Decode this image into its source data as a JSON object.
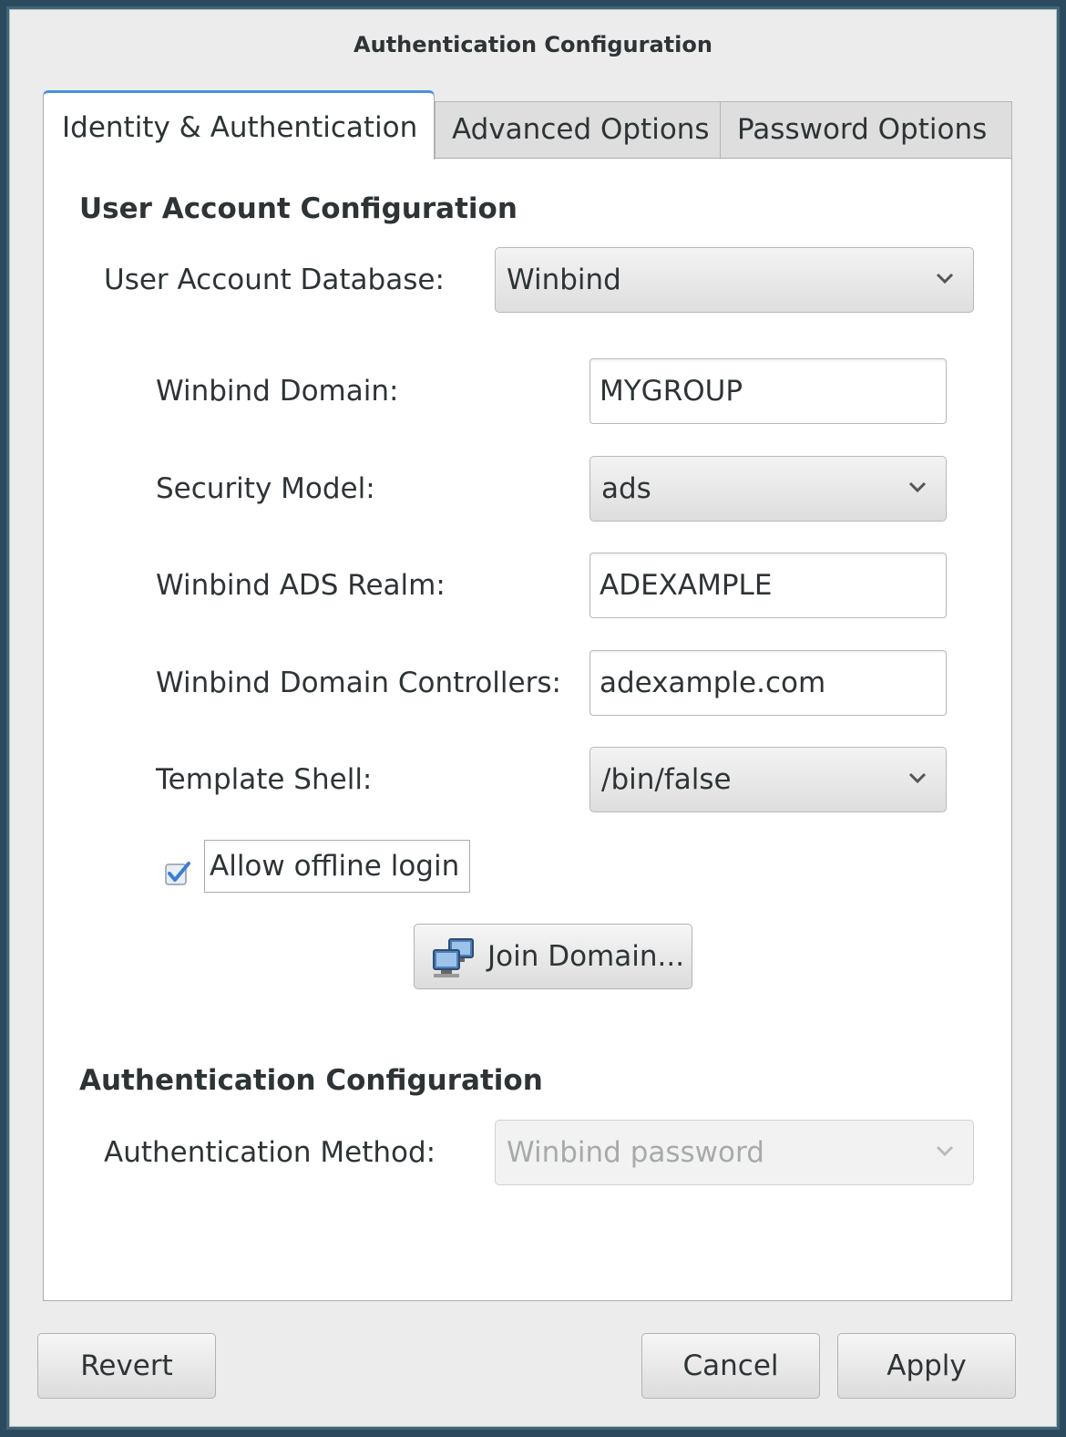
{
  "window": {
    "title": "Authentication Configuration"
  },
  "tabs": [
    {
      "label": "Identity & Authentication",
      "active": true
    },
    {
      "label": "Advanced Options",
      "active": false
    },
    {
      "label": "Password Options",
      "active": false
    }
  ],
  "user_account": {
    "heading": "User Account Configuration",
    "database_label": "User Account Database:",
    "database_value": "Winbind",
    "winbind_domain_label": "Winbind Domain:",
    "winbind_domain_value": "MYGROUP",
    "security_model_label": "Security Model:",
    "security_model_value": "ads",
    "ads_realm_label": "Winbind ADS Realm:",
    "ads_realm_value": "ADEXAMPLE",
    "domain_controllers_label": "Winbind Domain Controllers:",
    "domain_controllers_value": "adexample.com",
    "template_shell_label": "Template Shell:",
    "template_shell_value": "/bin/false",
    "offline_login_label": "Allow offline login",
    "offline_login_checked": true,
    "join_domain_label": "Join Domain..."
  },
  "authentication": {
    "heading": "Authentication Configuration",
    "method_label": "Authentication Method:",
    "method_value": "Winbind password",
    "method_disabled": true
  },
  "footer": {
    "revert_label": "Revert",
    "cancel_label": "Cancel",
    "apply_label": "Apply"
  },
  "icons": {
    "dropdown": "chevron-down-icon",
    "checkbox": "checkmark-icon",
    "join": "network-computers-icon"
  },
  "colors": {
    "accent": "#4a90d9",
    "checkbox": "#3b7dd8",
    "outer_border": "#3f6678"
  }
}
